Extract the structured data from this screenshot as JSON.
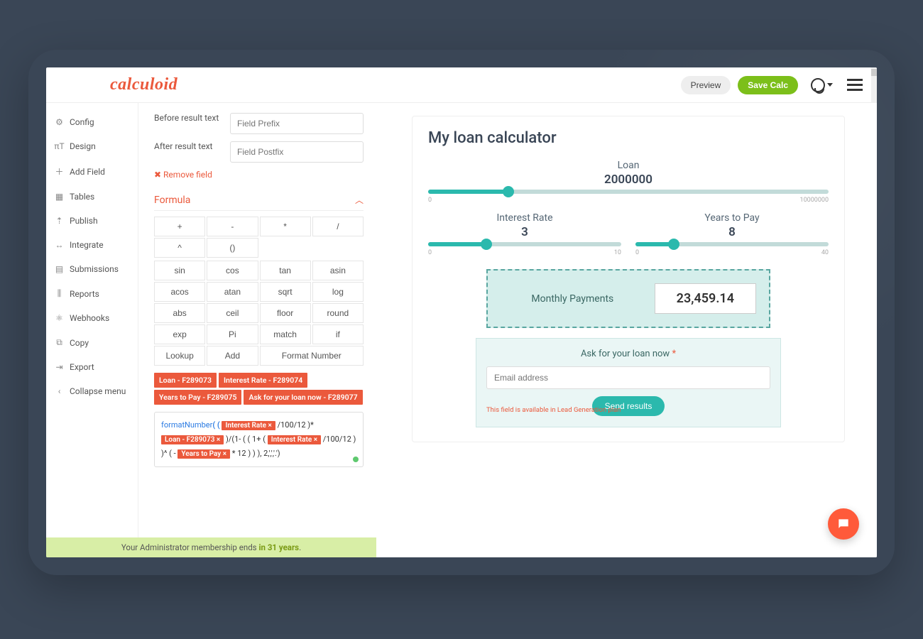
{
  "header": {
    "logo": "calculoid",
    "preview": "Preview",
    "save": "Save Calc"
  },
  "sidebar": {
    "items": [
      {
        "icon": "⚙",
        "label": "Config"
      },
      {
        "icon": "πT",
        "label": "Design"
      },
      {
        "icon": "＋",
        "label": "Add Field"
      },
      {
        "icon": "▦",
        "label": "Tables"
      },
      {
        "icon": "⇡",
        "label": "Publish"
      },
      {
        "icon": "↔",
        "label": "Integrate"
      },
      {
        "icon": "▤",
        "label": "Submissions"
      },
      {
        "icon": "⫼",
        "label": "Reports"
      },
      {
        "icon": "⚛",
        "label": "Webhooks"
      },
      {
        "icon": "⧉",
        "label": "Copy"
      },
      {
        "icon": "⇥",
        "label": "Export"
      },
      {
        "icon": "‹",
        "label": "Collapse menu"
      }
    ]
  },
  "editor": {
    "before_label": "Before result text",
    "before_placeholder": "Field Prefix",
    "after_label": "After result text",
    "after_placeholder": "Field Postfix",
    "remove": "✖ Remove field",
    "formula_title": "Formula",
    "ops": [
      "+",
      "-",
      "*",
      "/",
      "^",
      "()"
    ],
    "funcs": [
      "sin",
      "cos",
      "tan",
      "asin",
      "acos",
      "atan",
      "sqrt",
      "log",
      "abs",
      "ceil",
      "floor",
      "round",
      "exp",
      "Pi",
      "match",
      "if"
    ],
    "extra": [
      "Lookup",
      "Add",
      "Format Number"
    ],
    "vars": [
      "Loan - F289073",
      "Interest Rate - F289074",
      "Years to Pay - F289075",
      "Ask for your loan now - F289077"
    ],
    "fn": "formatNumber",
    "v_interest": "Interest Rate ×",
    "v_loan": "Loan - F289073 ×",
    "v_interest2": "Interest Rate ×",
    "v_years": "Years to Pay ×",
    "t100a": " /100/12 )*",
    "t_div": " )/(1- ( ( 1+ ( ",
    "t100b": " /100/12  ) )^ ( - ",
    "t_end": " * 12 )   )  ), 2,',','.')"
  },
  "preview": {
    "title": "My loan calculator",
    "loan": {
      "label": "Loan",
      "value": "2000000",
      "min": "0",
      "max": "10000000",
      "pct": 20
    },
    "rate": {
      "label": "Interest Rate",
      "value": "3",
      "min": "0",
      "max": "10",
      "pct": 30
    },
    "years": {
      "label": "Years to Pay",
      "value": "8",
      "min": "0",
      "max": "40",
      "pct": 20
    },
    "monthly_label": "Monthly Payments",
    "monthly_value": "23,459.14",
    "ask_title": "Ask for your loan now",
    "email_ph": "Email address",
    "send": "Send results",
    "note": "This field is available in Lead Generation plan"
  },
  "membership": {
    "pre": "Your Administrator membership ends ",
    "bold": "in 31 years",
    "post": "."
  }
}
